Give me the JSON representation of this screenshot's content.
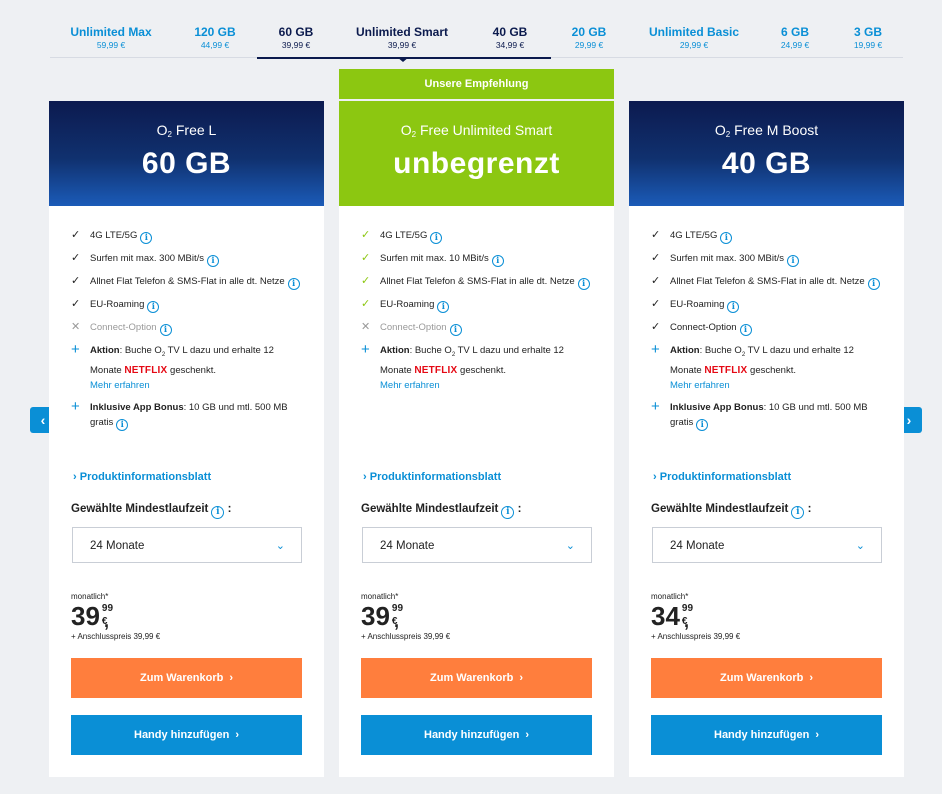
{
  "tabs": [
    {
      "name": "Unlimited Max",
      "price": "59,99 €"
    },
    {
      "name": "120 GB",
      "price": "44,99 €"
    },
    {
      "name": "60 GB",
      "price": "39,99 €"
    },
    {
      "name": "Unlimited Smart",
      "price": "39,99 €"
    },
    {
      "name": "40 GB",
      "price": "34,99 €"
    },
    {
      "name": "20 GB",
      "price": "29,99 €"
    },
    {
      "name": "Unlimited Basic",
      "price": "29,99 €"
    },
    {
      "name": "6 GB",
      "price": "24,99 €"
    },
    {
      "name": "3 GB",
      "price": "19,99 €"
    }
  ],
  "recommend_label": "Unsere Empfehlung",
  "common": {
    "o2": "O",
    "o2_sub": "2",
    "info": "i",
    "pib_label": "Produktinformationsblatt",
    "pib_arrow": "›",
    "mlabel": "Gewählte Mindestlaufzeit",
    "mlabel_colon": ":",
    "term": "24 Monate",
    "monthly": "monatlich*",
    "comma": ",",
    "currency": "€",
    "setup": "+ Anschlusspreis 39,99 €",
    "cart_btn": "Zum Warenkorb",
    "phone_btn": "Handy hinzufügen",
    "btn_arrow": "›",
    "chev": "⌄",
    "check": "✓",
    "cross": "✕",
    "plus": "+",
    "netflix": "NETFLIX",
    "aktion_bold": "Aktion",
    "aktion_text_1": ": Buche O",
    "aktion_sub": "2",
    "aktion_text_2": " TV L dazu und erhalte 12 Monate ",
    "aktion_text_3": " geschenkt.",
    "more": "Mehr erfahren",
    "bonus_bold": "Inklusive App Bonus",
    "bonus_text": ": 10 GB und mtl. 500 MB gratis",
    "f_lte": "4G LTE/5G",
    "f_flat": "Allnet Flat Telefon & SMS-Flat in alle dt. Netze",
    "f_roaming": "EU-Roaming",
    "f_connect": "Connect-Option"
  },
  "cards": [
    {
      "name": "Free L",
      "volume": "60 GB",
      "speed": "Surfen mit max. 300 MBit/s",
      "price_int": "39",
      "price_dec": "99"
    },
    {
      "name": "Free Unlimited Smart",
      "volume": "unbegrenzt",
      "speed": "Surfen mit max. 10 MBit/s",
      "price_int": "39",
      "price_dec": "99"
    },
    {
      "name": "Free M Boost",
      "volume": "40 GB",
      "speed": "Surfen mit max. 300 MBit/s",
      "price_int": "34",
      "price_dec": "99"
    }
  ],
  "nav": {
    "prev": "‹",
    "next": "›"
  },
  "colors": {
    "accent": "#0a8fd6",
    "green": "#8cc711",
    "orange": "#ff7e3d",
    "navy": "#0b1a4d"
  }
}
